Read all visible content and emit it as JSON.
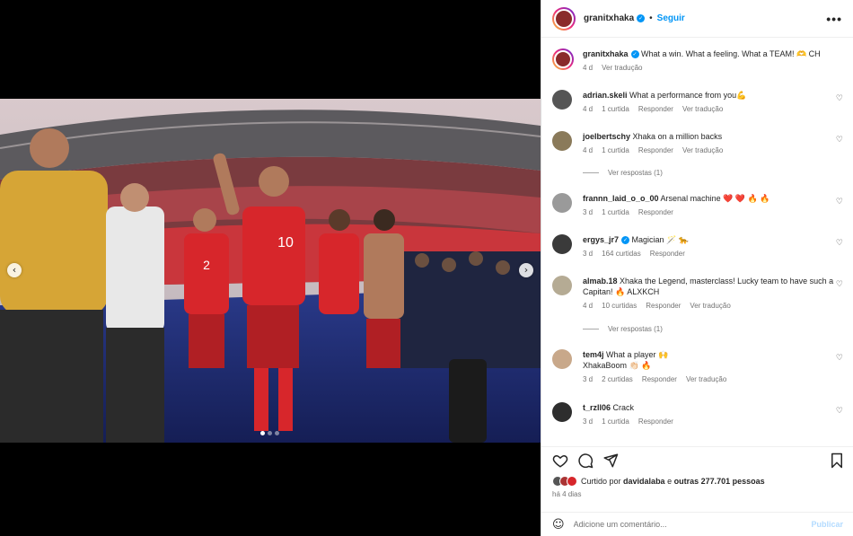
{
  "post": {
    "username": "granitxhaka",
    "follow_label": "Seguir",
    "dot_separator": "•",
    "more_icon": "more-horizontal-icon"
  },
  "caption": {
    "username": "granitxhaka",
    "text": "What a win. What a feeling. What a TEAM! 🫶 CH",
    "age": "4 d",
    "translate": "Ver tradução"
  },
  "comments": [
    {
      "username": "adrian.skeli",
      "text": "What a performance from you💪",
      "age": "4 d",
      "likes": "1 curtida",
      "reply": "Responder",
      "translate": "Ver tradução",
      "verified": false
    },
    {
      "username": "joelbertschy",
      "text": "Xhaka on a million backs",
      "age": "4 d",
      "likes": "1 curtida",
      "reply": "Responder",
      "translate": "Ver tradução",
      "verified": false,
      "view_replies": "Ver respostas (1)"
    },
    {
      "username": "frannn_laid_o_o_00",
      "text": "Arsenal machine ❤️ ❤️ 🔥 🔥",
      "age": "3 d",
      "likes": "1 curtida",
      "reply": "Responder",
      "verified": false
    },
    {
      "username": "ergys_jr7",
      "text": "Magician 🪄 🐆",
      "age": "3 d",
      "likes": "164 curtidas",
      "reply": "Responder",
      "verified": true
    },
    {
      "username": "almab.18",
      "text": "Xhaka the Legend, masterclass! Lucky team to have such a Capitan! 🔥 ALXKCH",
      "age": "4 d",
      "likes": "10 curtidas",
      "reply": "Responder",
      "translate": "Ver tradução",
      "verified": false,
      "view_replies": "Ver respostas (1)"
    },
    {
      "username": "tem4j",
      "text": "What a player 🙌",
      "text2": "XhakaBoom 👏🏻 🔥",
      "age": "3 d",
      "likes": "2 curtidas",
      "reply": "Responder",
      "translate": "Ver tradução",
      "verified": false
    },
    {
      "username": "t_rzll06",
      "text": "Crack",
      "age": "3 d",
      "likes": "1 curtida",
      "reply": "Responder",
      "verified": false
    }
  ],
  "likes": {
    "prefix": "Curtido por",
    "user": "davidalaba",
    "middle": "e",
    "others": "outras 277.701 pessoas"
  },
  "date": "há 4 dias",
  "add_comment": {
    "placeholder": "Adicione um comentário...",
    "publish": "Publicar",
    "emoji_icon": "smiley-icon"
  },
  "colors": {
    "accent": "#0095f6",
    "publish_disabled": "#b3dbff",
    "kit_red": "#d7262b"
  }
}
